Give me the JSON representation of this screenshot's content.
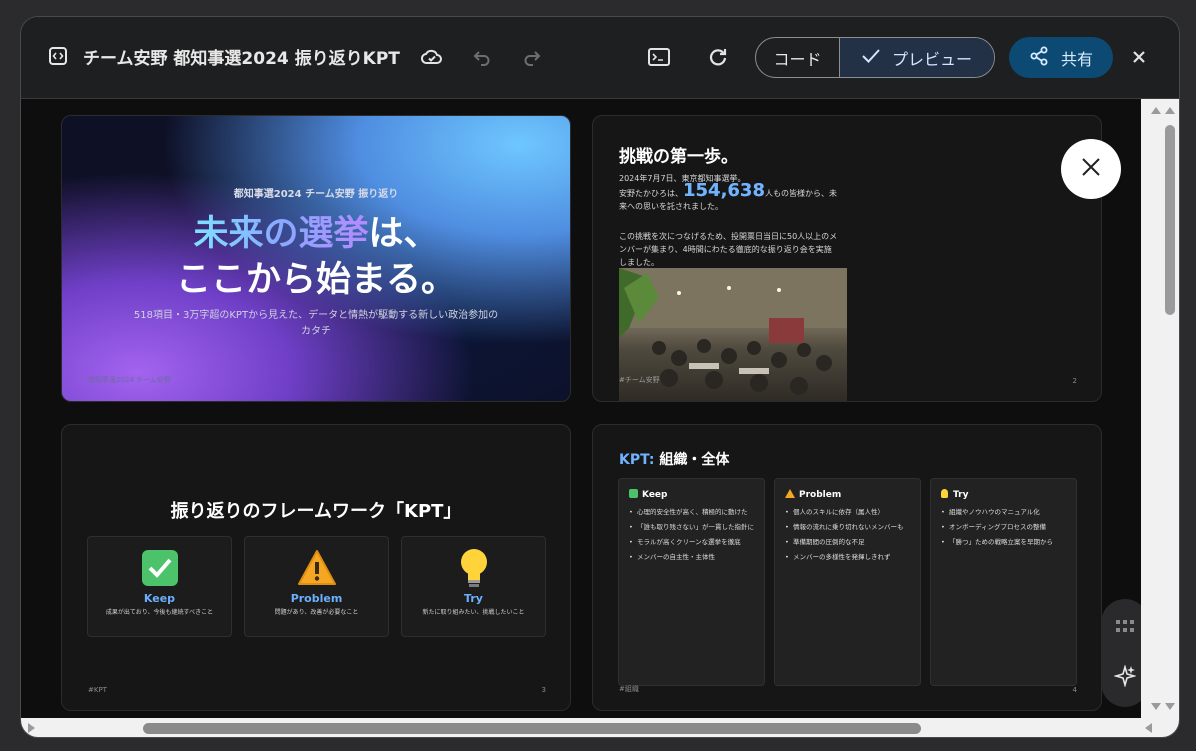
{
  "app": {
    "title": "チーム安野 都知事選2024 振り返りKPT"
  },
  "toolbar": {
    "code_label": "コード",
    "preview_label": "プレビュー",
    "share_label": "共有"
  },
  "icons": {
    "app": "code-box-icon",
    "cloud": "cloud-check-icon",
    "undo": "undo-icon",
    "redo": "redo-icon",
    "terminal": "terminal-icon",
    "refresh": "refresh-icon",
    "share": "share-icon",
    "close": "close-icon",
    "check": "check-icon",
    "grid": "grid-icon",
    "sparkle": "sparkle-icon"
  },
  "colors": {
    "accent": "#0d4a73",
    "preview_bg": "#233146"
  },
  "slides": [
    {
      "kicker": "都知事選2024 チーム安野 振り返り",
      "title_part1": "未来の選挙",
      "title_part2": "は、",
      "title_line2": "ここから始まる。",
      "subtitle": "518項目・3万字超のKPTから見えた、データと情熱が駆動する新しい政治参加のカタチ",
      "footer": "都知事選2024 チーム安野"
    },
    {
      "title": "挑戦の第一歩。",
      "date_line": "2024年7月7日、東京都知事選挙。",
      "p1_pre": "安野たかひろは、",
      "big_number": "154,638",
      "p1_post": "人もの皆様から、未来への思いを託されました。",
      "p2": "この挑戦を次につなげるため、投開票日当日に50人以上のメンバーが集まり、4時間にわたる徹底的な振り返り会を実施しました。",
      "footer": "#チーム安野",
      "page": "2"
    },
    {
      "title": "振り返りのフレームワーク「KPT」",
      "cards": [
        {
          "label": "Keep",
          "desc": "成果が出ており、今後も継続すべきこと",
          "icon": "check-box-icon"
        },
        {
          "label": "Problem",
          "desc": "問題があり、改善が必要なこと",
          "icon": "warning-icon"
        },
        {
          "label": "Try",
          "desc": "新たに取り組みたい、挑戦したいこと",
          "icon": "lightbulb-icon"
        }
      ],
      "footer": "#KPT",
      "page": "3"
    },
    {
      "title_accent": "KPT:",
      "title_rest": " 組織・全体",
      "cols": [
        {
          "head": "Keep",
          "items": [
            "心理的安全性が高く、積極的に動けた",
            "「誰も取り残さない」が一貫した指針に",
            "モラルが高くクリーンな選挙を徹底",
            "メンバーの自主性・主体性"
          ]
        },
        {
          "head": "Problem",
          "items": [
            "個人のスキルに依存（属人性）",
            "情報の流れに乗り切れないメンバーも",
            "準備期間の圧倒的な不足",
            "メンバーの多様性を発揮しきれず"
          ]
        },
        {
          "head": "Try",
          "items": [
            "組織やノウハウのマニュアル化",
            "オンボーディングプロセスの整備",
            "「勝つ」ための戦略立案を早期から"
          ]
        }
      ],
      "footer": "#組織",
      "page": "4"
    }
  ]
}
